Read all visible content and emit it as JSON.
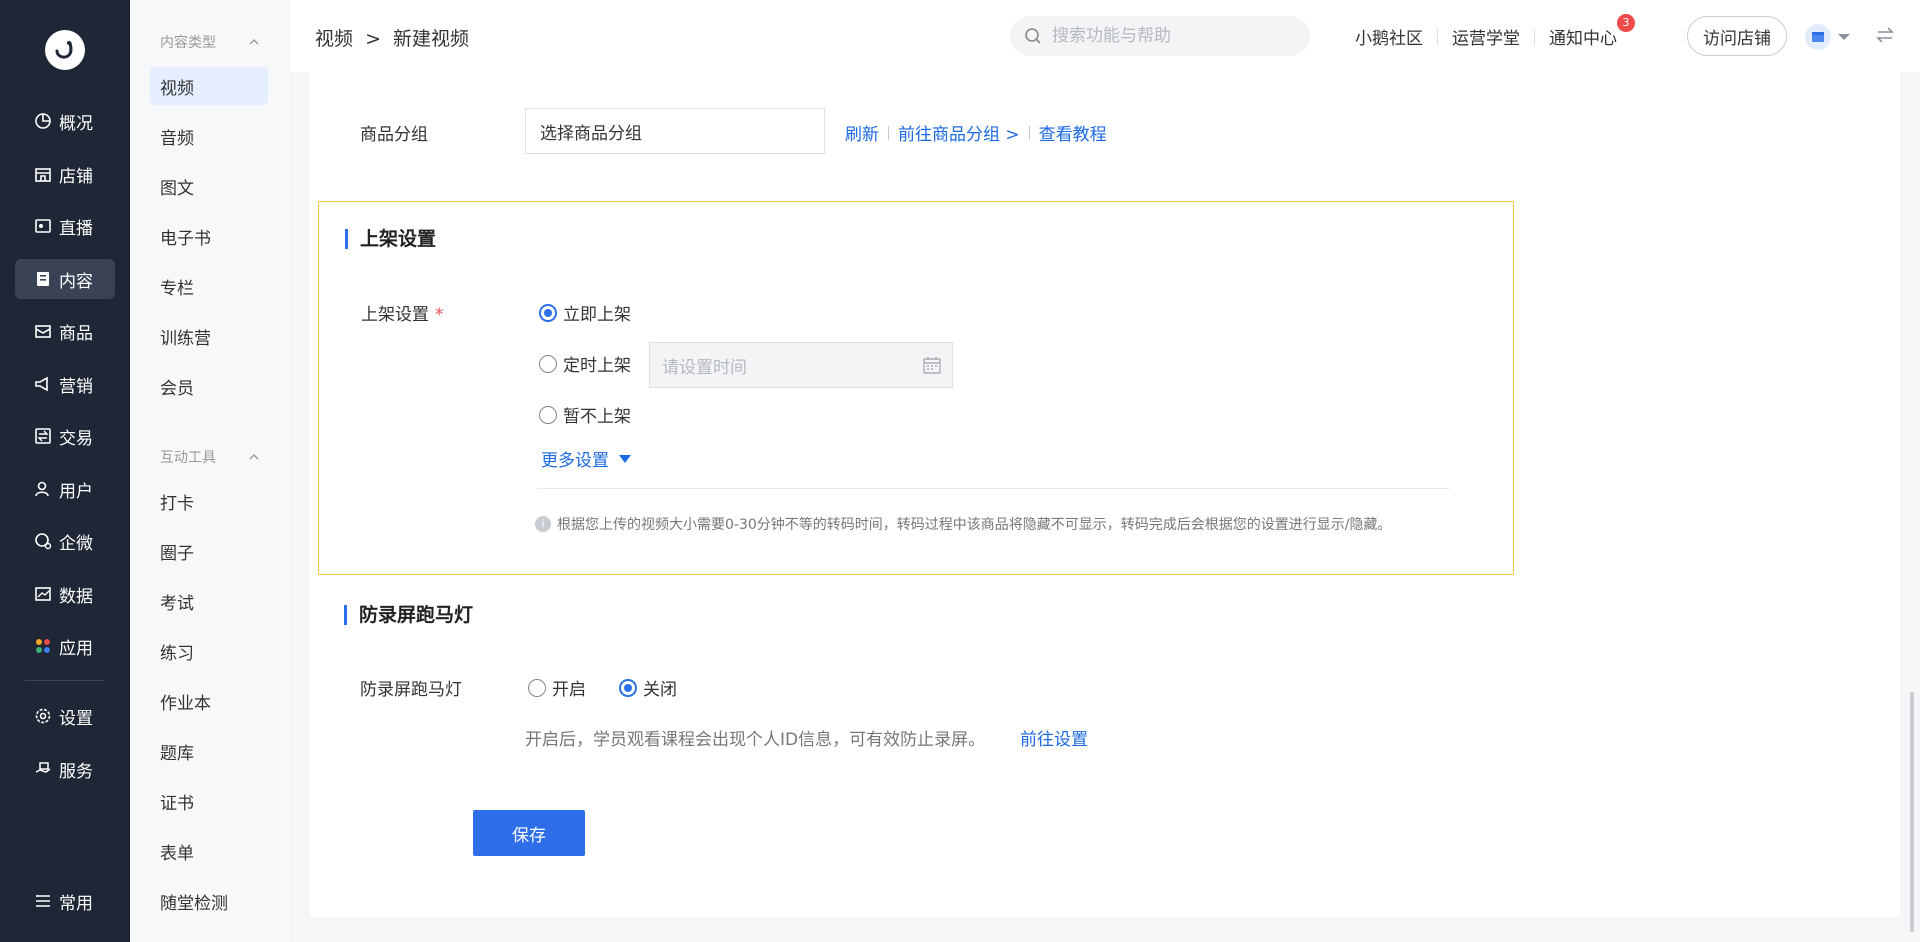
{
  "nav": {
    "items": [
      {
        "label": "概况",
        "icon": "overview-icon"
      },
      {
        "label": "店铺",
        "icon": "store-icon"
      },
      {
        "label": "直播",
        "icon": "live-icon"
      },
      {
        "label": "内容",
        "icon": "content-icon"
      },
      {
        "label": "商品",
        "icon": "goods-icon"
      },
      {
        "label": "营销",
        "icon": "marketing-icon"
      },
      {
        "label": "交易",
        "icon": "trade-icon"
      },
      {
        "label": "用户",
        "icon": "user-icon"
      },
      {
        "label": "企微",
        "icon": "wecom-icon"
      },
      {
        "label": "数据",
        "icon": "data-icon"
      },
      {
        "label": "应用",
        "icon": "apps-icon"
      },
      {
        "label": "设置",
        "icon": "settings-icon"
      },
      {
        "label": "服务",
        "icon": "service-icon"
      },
      {
        "label": "常用",
        "icon": "menu-icon"
      }
    ]
  },
  "submenu": {
    "group1": "内容类型",
    "group1_items": [
      "视频",
      "音频",
      "图文",
      "电子书",
      "专栏",
      "训练营",
      "会员"
    ],
    "group2": "互动工具",
    "group2_items": [
      "打卡",
      "圈子",
      "考试",
      "练习",
      "作业本",
      "题库",
      "证书",
      "表单",
      "随堂检测"
    ]
  },
  "topbar": {
    "breadcrumb_parent": "视频",
    "breadcrumb_sep": ">",
    "breadcrumb_current": "新建视频",
    "search_placeholder": "搜索功能与帮助",
    "link_community": "小鹅社区",
    "link_academy": "运营学堂",
    "link_notice": "通知中心",
    "notice_count": "3",
    "visit_store": "访问店铺"
  },
  "form": {
    "group_label": "商品分组",
    "group_select": "选择商品分组",
    "link_refresh": "刷新",
    "link_goto_group": "前往商品分组 >",
    "link_tutorial": "查看教程",
    "publish_section_title": "上架设置",
    "publish_label": "上架设置",
    "publish_required": "*",
    "publish_options": [
      "立即上架",
      "定时上架",
      "暂不上架"
    ],
    "publish_selected": 0,
    "time_placeholder": "请设置时间",
    "more_settings": "更多设置",
    "hint_icon": "i",
    "hint": "根据您上传的视频大小需要0-30分钟不等的转码时间，转码过程中该商品将隐藏不可显示，转码完成后会根据您的设置进行显示/隐藏。",
    "marquee_section_title": "防录屏跑马灯",
    "marquee_label": "防录屏跑马灯",
    "marquee_options": [
      "开启",
      "关闭"
    ],
    "marquee_selected": 1,
    "marquee_desc": "开启后，学员观看课程会出现个人ID信息，可有效防止录屏。",
    "marquee_link": "前往设置",
    "save": "保存"
  },
  "colors": {
    "nav_bg": "#1f2635",
    "accent": "#2f6ee9",
    "link": "#1c6ae4",
    "section_border": "#f2c94c",
    "badge": "#f04a4a"
  }
}
